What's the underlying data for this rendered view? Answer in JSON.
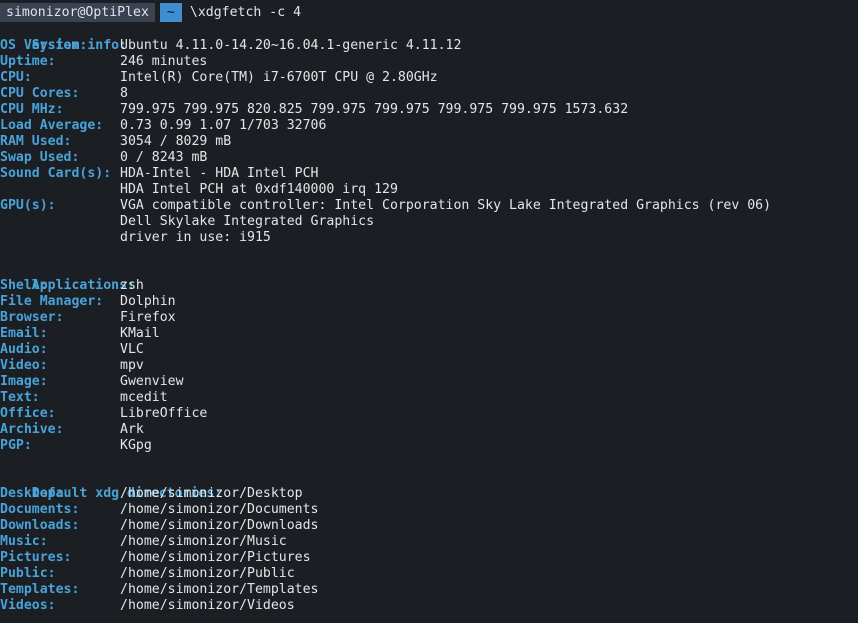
{
  "prompt": {
    "user_host": "simonizor@OptiPlex",
    "directory": "~",
    "command": "\\xdgfetch -c 4"
  },
  "system_info": {
    "heading": "System info:",
    "rows": [
      {
        "key": "OS Version:",
        "value": "Ubuntu 4.11.0-14.20~16.04.1-generic 4.11.12"
      },
      {
        "key": "Uptime:",
        "value": "246 minutes"
      },
      {
        "key": "CPU:",
        "value": "Intel(R) Core(TM) i7-6700T CPU @ 2.80GHz"
      },
      {
        "key": "CPU Cores:",
        "value": "8"
      },
      {
        "key": "CPU MHz:",
        "value": "799.975 799.975 820.825 799.975 799.975 799.975 799.975 1573.632"
      },
      {
        "key": "Load Average:",
        "value": "0.73 0.99 1.07 1/703 32706"
      },
      {
        "key": "RAM Used:",
        "value": "3054 / 8029 mB"
      },
      {
        "key": "Swap Used:",
        "value": "0 / 8243 mB"
      },
      {
        "key": "Sound Card(s):",
        "value": "HDA-Intel - HDA Intel PCH"
      },
      {
        "key": "",
        "value": "HDA Intel PCH at 0xdf140000 irq 129"
      },
      {
        "key": "GPU(s):",
        "value": "VGA compatible controller: Intel Corporation Sky Lake Integrated Graphics (rev 06)"
      },
      {
        "key": "",
        "value": "Dell Skylake Integrated Graphics"
      },
      {
        "key": "",
        "value": "driver in use: i915"
      }
    ]
  },
  "applications": {
    "heading": "Applications:",
    "rows": [
      {
        "key": "Shell:",
        "value": "zsh"
      },
      {
        "key": "File Manager:",
        "value": "Dolphin"
      },
      {
        "key": "Browser:",
        "value": "Firefox"
      },
      {
        "key": "Email:",
        "value": "KMail"
      },
      {
        "key": "Audio:",
        "value": "VLC"
      },
      {
        "key": "Video:",
        "value": "mpv"
      },
      {
        "key": "Image:",
        "value": "Gwenview"
      },
      {
        "key": "Text:",
        "value": "mcedit"
      },
      {
        "key": "Office:",
        "value": "LibreOffice"
      },
      {
        "key": "Archive:",
        "value": "Ark"
      },
      {
        "key": "PGP:",
        "value": "KGpg"
      }
    ]
  },
  "xdg_dirs": {
    "heading": "Default xdg directories:",
    "rows": [
      {
        "key": "Desktop:",
        "value": "/home/simonizor/Desktop"
      },
      {
        "key": "Documents:",
        "value": "/home/simonizor/Documents"
      },
      {
        "key": "Downloads:",
        "value": "/home/simonizor/Downloads"
      },
      {
        "key": "Music:",
        "value": "/home/simonizor/Music"
      },
      {
        "key": "Pictures:",
        "value": "/home/simonizor/Pictures"
      },
      {
        "key": "Public:",
        "value": "/home/simonizor/Public"
      },
      {
        "key": "Templates:",
        "value": "/home/simonizor/Templates"
      },
      {
        "key": "Videos:",
        "value": "/home/simonizor/Videos"
      }
    ]
  },
  "colors": {
    "background": "#1b1f24",
    "key_blue": "#4aa3d8",
    "text": "#e3e5e8",
    "prompt_user_bg": "#3b4252",
    "prompt_dir_bg": "#3d8fd1"
  }
}
